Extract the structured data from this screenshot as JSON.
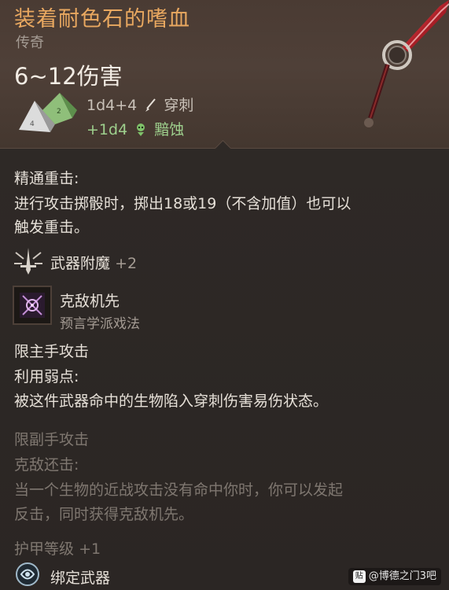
{
  "item": {
    "name": "装着耐色石的嗜血",
    "rarity": "传奇",
    "damage": "6~12伤害",
    "damage_rows": [
      {
        "dice": "1d4+4",
        "type": "穿刺"
      },
      {
        "dice": "+1d4",
        "type": "黯蚀"
      }
    ]
  },
  "passives": [
    {
      "title": "精通重击:",
      "lines": [
        "进行攻击掷骰时，掷出18或19（不含加值）也可以",
        "触发重击。"
      ]
    }
  ],
  "enchant": {
    "label": "武器附魔",
    "bonus": "+2"
  },
  "spell": {
    "name": "克敌机先",
    "school": "预言学派戏法"
  },
  "main_hand": {
    "heading": "限主手攻击",
    "title": "利用弱点:",
    "lines": [
      "被这件武器命中的生物陷入穿刺伤害易伤状态。"
    ]
  },
  "off_hand": {
    "heading": "限副手攻击",
    "title": "克敌还击:",
    "lines": [
      "当一个生物的近战攻击没有命中你时，你可以发起",
      "反击，同时获得克敌机先。"
    ]
  },
  "armor": {
    "label": "护甲等级",
    "bonus": "+1"
  },
  "bound": {
    "label": "绑定武器"
  },
  "watermark": {
    "logo": "贴",
    "text": "@博德之门3吧"
  },
  "icons": [
    "dice-icon",
    "piercing-icon",
    "necrotic-icon",
    "weapon-enchant-icon",
    "spell-icon",
    "bound-weapon-icon",
    "weapon-image"
  ]
}
